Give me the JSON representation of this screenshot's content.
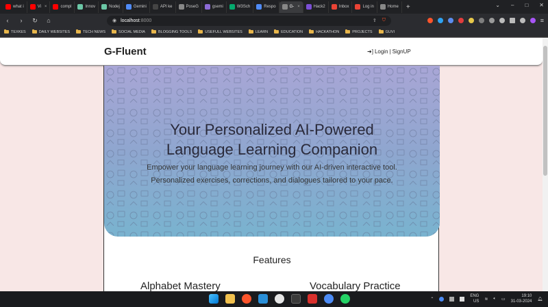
{
  "browser": {
    "tabs": [
      {
        "label": "what i",
        "color": "#ff0000"
      },
      {
        "label": "Vi",
        "color": "#ff0000",
        "close": "×"
      },
      {
        "label": "compl",
        "color": "#ff0000"
      },
      {
        "label": "Innov",
        "color": "#6bc7a6"
      },
      {
        "label": "Nodej",
        "color": "#6bc7a6"
      },
      {
        "label": "Gemini",
        "color": "#4f8bf7"
      },
      {
        "label": "API ke",
        "color": "#444"
      },
      {
        "label": "PoseG",
        "color": "#888"
      },
      {
        "label": "gsemi",
        "color": "#8c6ad6"
      },
      {
        "label": "W3Sch",
        "color": "#04aa6d"
      },
      {
        "label": "Respo",
        "color": "#4f8bf7"
      },
      {
        "label": "G-",
        "color": "#888",
        "close": "×",
        "active": true
      },
      {
        "label": "Hack2",
        "color": "#7b4fd6"
      },
      {
        "label": "Inbox",
        "color": "#ea4335"
      },
      {
        "label": "Log in",
        "color": "#ea4335"
      },
      {
        "label": "Home",
        "color": "#888"
      }
    ],
    "new_tab": "+",
    "window_controls": [
      "⌄",
      "–",
      "□",
      "✕"
    ],
    "nav": {
      "back": "‹",
      "forward": "›",
      "reload": "↻",
      "home": "⌂"
    },
    "url_host": "localhost",
    "url_port": ":8000",
    "bookmarks": [
      "TEXKES",
      "DAILY WEBSITES",
      "TECH NEWS",
      "SOCIAL MEDIA",
      "BLOGGING TOOLS",
      "USEFULL WEBSITES",
      "LEARN",
      "EDUCATION",
      "HACKATHON",
      "PROJECTS",
      "GUVI"
    ]
  },
  "site": {
    "brand": "G-Fluent",
    "login": "Login",
    "separator": "|",
    "signup": "SignUP",
    "hero_title_line1": "Your Personalized AI-Powered",
    "hero_title_line2": "Language Learning Companion",
    "hero_sub_line1": "Empower your language learning journey with our AI-driven interactive tool.",
    "hero_sub_line2": "Personalized exercises, corrections, and dialogues tailored to your pace.",
    "features_title": "Features",
    "feature_1": "Alphabet Mastery",
    "feature_2": "Vocabulary Practice"
  },
  "taskbar": {
    "lang_line1": "ENG",
    "lang_line2": "US",
    "time": "19:10",
    "date": "31-03-2024"
  }
}
